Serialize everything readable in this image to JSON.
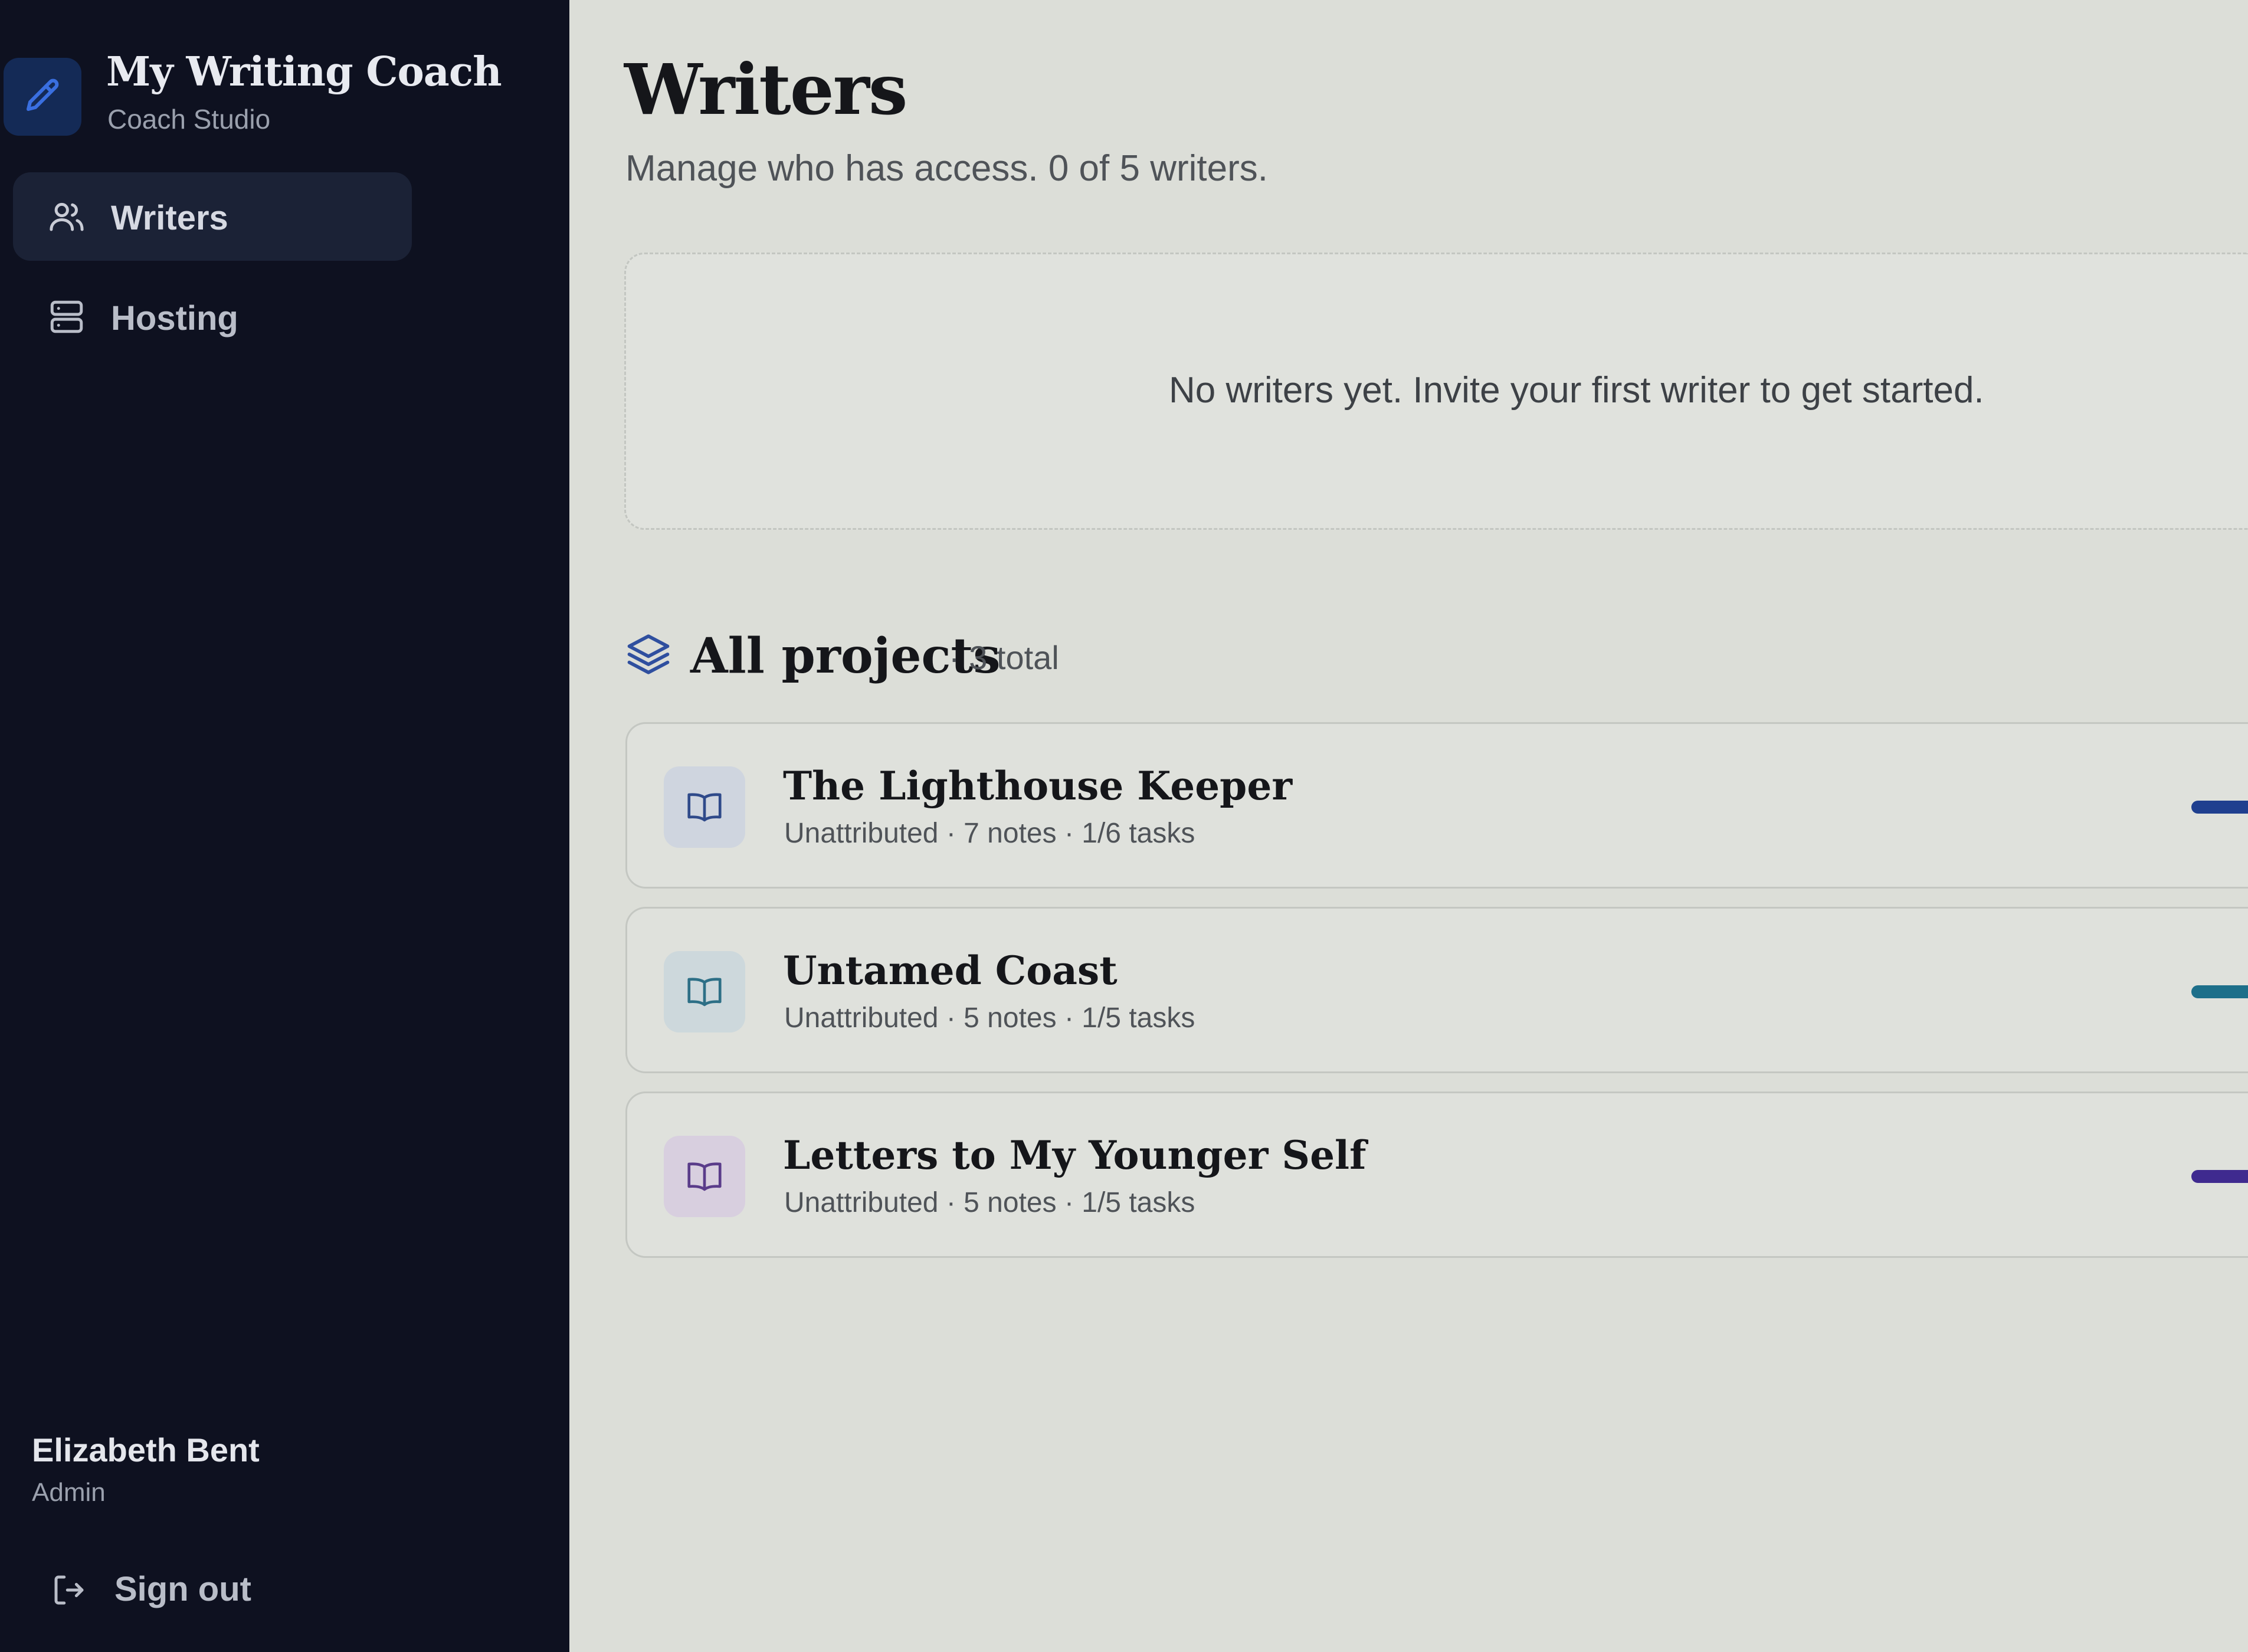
{
  "app": {
    "title": "My Writing Coach",
    "subtitle": "Coach Studio",
    "logo_icon": "pen-icon"
  },
  "sidebar": {
    "items": [
      {
        "label": "Writers",
        "icon": "users-icon",
        "active": true
      },
      {
        "label": "Hosting",
        "icon": "server-icon",
        "active": false
      }
    ],
    "user": {
      "name": "Elizabeth Bent",
      "role": "Admin"
    },
    "signout_label": "Sign out"
  },
  "main": {
    "title": "Writers",
    "subtitle": "Manage who has access. 0 of 5 writers.",
    "empty_message": "No writers yet. Invite your first writer to get started."
  },
  "projects": {
    "heading": "All projects",
    "count": "· 3 total",
    "items": [
      {
        "name": "The Lighthouse Keeper",
        "meta": "Unattributed · 7 notes · 1/6 tasks",
        "tile_color": "#cfd5df",
        "icon_color": "#2f4a8a",
        "accent": "#1f3f8f"
      },
      {
        "name": "Untamed Coast",
        "meta": "Unattributed · 5 notes · 1/5 tasks",
        "tile_color": "#cdd8dc",
        "icon_color": "#2d6f86",
        "accent": "#1d6f8a"
      },
      {
        "name": "Letters to My Younger Self",
        "meta": "Unattributed · 5 notes · 1/5 tasks",
        "tile_color": "#d8cfdf",
        "icon_color": "#5a3c8a",
        "accent": "#3f2a8f"
      }
    ]
  },
  "colors": {
    "sidebar_bg": "#0e1120",
    "main_bg": "#dcded8",
    "brand_accent": "#3a6fe0"
  }
}
